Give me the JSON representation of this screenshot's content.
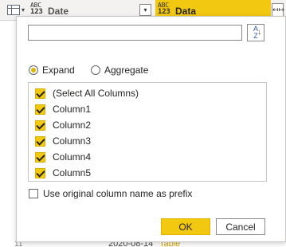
{
  "header": {
    "date_column": {
      "type_top": "ABC",
      "type_bottom": "123",
      "label": "Date",
      "dropdown_glyph": "▾"
    },
    "data_column": {
      "type_top": "ABC",
      "type_bottom": "123",
      "label": "Data",
      "expand_glyph": "↤↦"
    },
    "table_dropdown_glyph": "▾"
  },
  "popup": {
    "search": {
      "value": "",
      "placeholder": ""
    },
    "sort_button": {
      "top": "A",
      "bottom": "Z",
      "arrow": "↓"
    },
    "modes": [
      {
        "label": "Expand",
        "selected": true
      },
      {
        "label": "Aggregate",
        "selected": false
      }
    ],
    "columns": [
      {
        "label": "(Select All Columns)",
        "checked": true
      },
      {
        "label": "Column1",
        "checked": true
      },
      {
        "label": "Column2",
        "checked": true
      },
      {
        "label": "Column3",
        "checked": true
      },
      {
        "label": "Column4",
        "checked": true
      },
      {
        "label": "Column5",
        "checked": true
      }
    ],
    "prefix_option": {
      "label": "Use original column name as prefix",
      "checked": false
    },
    "ok_label": "OK",
    "cancel_label": "Cancel"
  },
  "background_row": {
    "row_number": "11",
    "date": "2020-08-14",
    "data": "Table"
  },
  "colors": {
    "accent": "#f2c811",
    "border": "#8a8886",
    "header_bg": "#f3f2f1"
  }
}
